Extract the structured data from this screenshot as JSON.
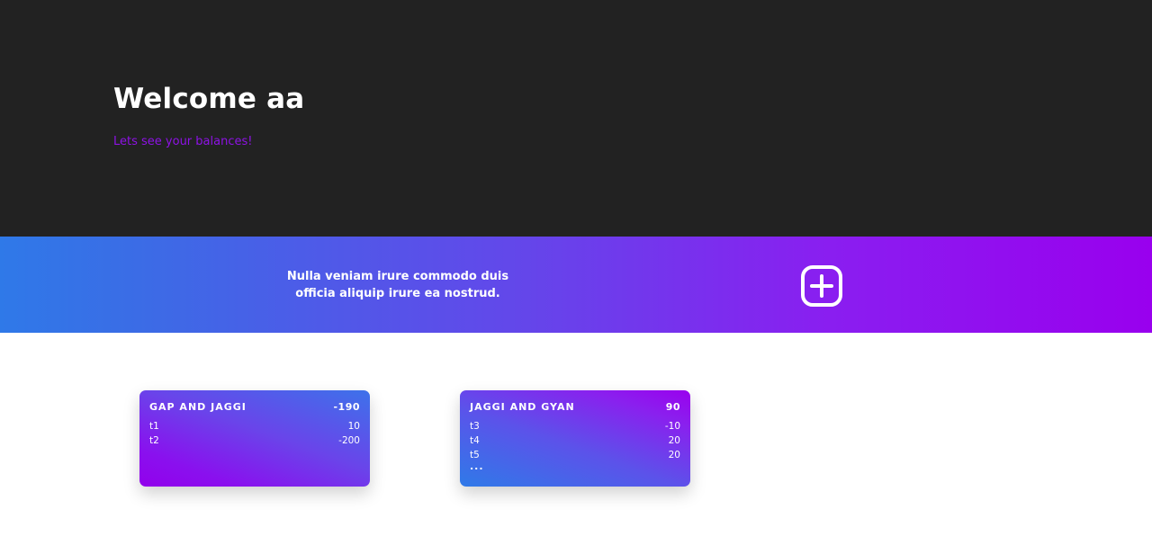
{
  "header": {
    "title": "Welcome aa",
    "subtitle": "Lets see your balances!"
  },
  "banner": {
    "text": "Nulla veniam irure commodo duis officia aliquip irure ea nostrud.",
    "add_icon": "plus-square-icon"
  },
  "groups": [
    {
      "name": "GAP AND JAGGI",
      "total": "-190",
      "items": [
        {
          "label": "t1",
          "amount": "10"
        },
        {
          "label": "t2",
          "amount": "-200"
        }
      ]
    },
    {
      "name": "JAGGI AND GYAN",
      "total": "90",
      "items": [
        {
          "label": "t3",
          "amount": "-10"
        },
        {
          "label": "t4",
          "amount": "20"
        },
        {
          "label": "t5",
          "amount": "20"
        }
      ],
      "more": "..."
    }
  ],
  "colors": {
    "hero_bg": "#222222",
    "accent_purple": "#8e12e6",
    "gradient_start": "#2f79e8",
    "gradient_end": "#9900ee"
  }
}
